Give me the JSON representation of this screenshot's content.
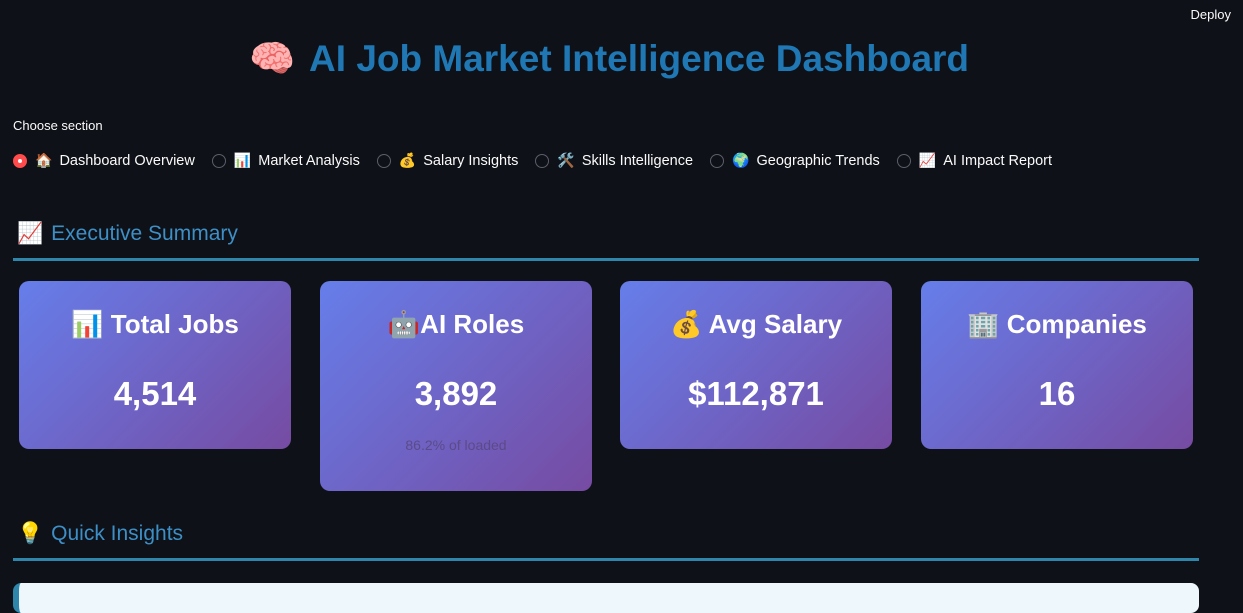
{
  "header": {
    "deploy_label": "Deploy"
  },
  "title": {
    "icon": "brain-icon",
    "icon_glyph": "🧠",
    "text": "AI Job Market Intelligence Dashboard"
  },
  "nav": {
    "label": "Choose section",
    "selected_index": 0,
    "options": [
      {
        "icon": "house-icon",
        "glyph": "🏠",
        "label": "Dashboard Overview"
      },
      {
        "icon": "bar-chart-icon",
        "glyph": "📊",
        "label": "Market Analysis"
      },
      {
        "icon": "money-bag-icon",
        "glyph": "💰",
        "label": "Salary Insights"
      },
      {
        "icon": "tools-icon",
        "glyph": "🛠️",
        "label": "Skills Intelligence"
      },
      {
        "icon": "globe-icon",
        "glyph": "🌍",
        "label": "Geographic Trends"
      },
      {
        "icon": "trend-chart-icon",
        "glyph": "📈",
        "label": "AI Impact Report"
      }
    ]
  },
  "executive_summary": {
    "icon": "trend-chart-icon",
    "glyph": "📈",
    "title": "Executive Summary"
  },
  "metrics": [
    {
      "icon": "bar-chart-icon",
      "glyph": "📊",
      "title": "Total Jobs",
      "value": "4,514",
      "sub": ""
    },
    {
      "icon": "robot-icon",
      "glyph": "🤖",
      "title": "AI Roles",
      "value": "3,892",
      "sub": "86.2% of loaded"
    },
    {
      "icon": "money-bag-icon",
      "glyph": "💰",
      "title": "Avg Salary",
      "value": "$112,871",
      "sub": ""
    },
    {
      "icon": "office-building-icon",
      "glyph": "🏢",
      "title": "Companies",
      "value": "16",
      "sub": ""
    }
  ],
  "quick_insights": {
    "icon": "light-bulb-icon",
    "glyph": "💡",
    "title": "Quick Insights"
  },
  "colors": {
    "background": "#0e1117",
    "title": "#1f77b4",
    "section_heading": "#3d8fc6",
    "divider": "#2e86ab",
    "radio_selected": "#ff4b4b",
    "card_gradient_start": "#667eea",
    "card_gradient_end": "#764ba2"
  }
}
